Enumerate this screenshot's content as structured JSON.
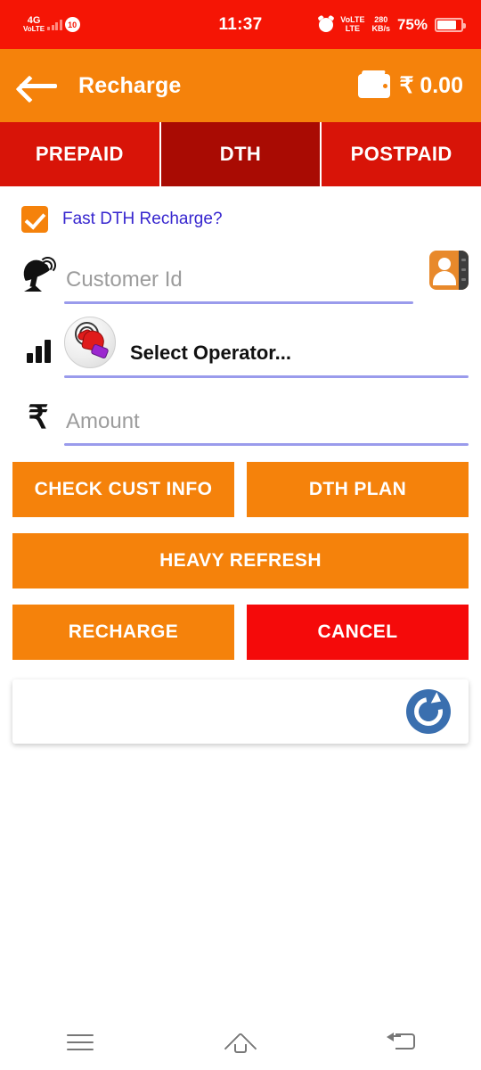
{
  "status_bar": {
    "network_type": "4G",
    "network_sub": "VoLTE",
    "dual_sim_badge": "10",
    "time": "11:37",
    "alarm_icon": "alarm-clock-icon",
    "volte_line1": "VoLTE",
    "volte_line2": "LTE",
    "data_speed_value": "280",
    "data_speed_unit": "KB/s",
    "battery_percent": "75%"
  },
  "header": {
    "back_icon": "back-arrow-icon",
    "title": "Recharge",
    "wallet_icon": "wallet-icon",
    "wallet_balance": "₹ 0.00",
    "background_color": "#F5820B"
  },
  "tabs": {
    "items": [
      {
        "label": "PREPAID",
        "active": false
      },
      {
        "label": "DTH",
        "active": true
      },
      {
        "label": "POSTPAID",
        "active": false
      }
    ],
    "inactive_color": "#D81408",
    "active_color": "#A90B03"
  },
  "form": {
    "fast_recharge": {
      "label": "Fast DTH Recharge?",
      "checked": true,
      "label_color": "#3726CF",
      "box_color": "#F5820B"
    },
    "customer_id": {
      "placeholder": "Customer Id",
      "value": "",
      "left_icon": "satellite-dish-icon",
      "right_icon": "contacts-book-icon"
    },
    "operator": {
      "label": "Select Operator...",
      "left_icon": "signal-bars-icon",
      "badge_icon": "tap-hand-icon"
    },
    "amount": {
      "placeholder": "Amount",
      "value": "",
      "left_icon": "rupee-symbol-icon"
    },
    "underline_color": "#9A9BEC"
  },
  "actions": {
    "check_cust_info": "CHECK CUST INFO",
    "dth_plan": "DTH PLAN",
    "heavy_refresh": "HEAVY REFRESH",
    "recharge": "RECHARGE",
    "cancel": "CANCEL",
    "orange": "#F5820B",
    "red": "#F50A0A"
  },
  "refresh_card": {
    "icon": "refresh-circle-icon",
    "icon_color": "#3A6FAF"
  },
  "navigation_bar": {
    "menu_icon": "menu-icon",
    "home_icon": "home-icon",
    "back_icon": "back-icon"
  }
}
